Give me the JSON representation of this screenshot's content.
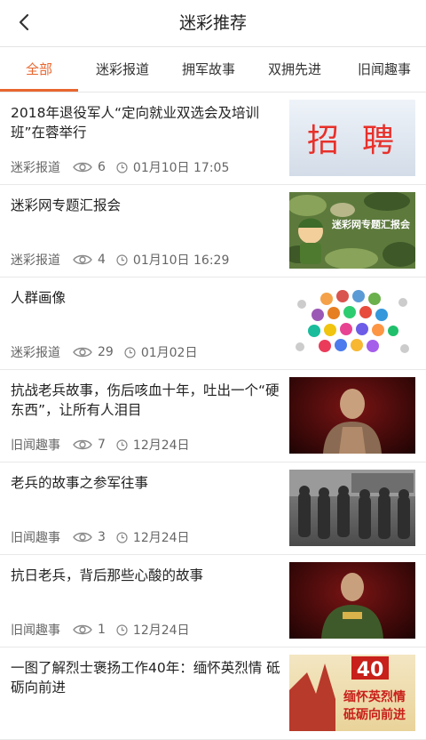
{
  "header": {
    "title": "迷彩推荐"
  },
  "tabs": [
    {
      "label": "全部",
      "active": true
    },
    {
      "label": "迷彩报道"
    },
    {
      "label": "拥军故事"
    },
    {
      "label": "双拥先进"
    },
    {
      "label": "旧闻趣事"
    }
  ],
  "colors": {
    "accent": "#e8662e",
    "text": "#222222",
    "meta": "#666666",
    "divider": "#e8e8e8"
  },
  "articles": [
    {
      "title": "2018年退役军人“定向就业双选会及培训班”在蓉举行",
      "source": "迷彩报道",
      "views": "6",
      "time": "01月10日 17:05",
      "thumb": {
        "text1": "招",
        "text2": "聘"
      }
    },
    {
      "title": "迷彩网专题汇报会",
      "source": "迷彩报道",
      "views": "4",
      "time": "01月10日 16:29",
      "thumb": {
        "text": "迷彩网专题汇报会"
      }
    },
    {
      "title": "人群画像",
      "source": "迷彩报道",
      "views": "29",
      "time": "01月02日",
      "thumb": {
        "kind": "people-avatars"
      }
    },
    {
      "title": "抗战老兵故事，伤后咳血十年，吐出一个“硬东西”，让所有人泪目",
      "source": "旧闻趣事",
      "views": "7",
      "time": "12月24日",
      "thumb": {
        "kind": "veteran-photo"
      }
    },
    {
      "title": "老兵的故事之参军往事",
      "source": "旧闻趣事",
      "views": "3",
      "time": "12月24日",
      "thumb": {
        "kind": "soldiers-photo"
      }
    },
    {
      "title": "抗日老兵，背后那些心酸的故事",
      "source": "旧闻趣事",
      "views": "1",
      "time": "12月24日",
      "thumb": {
        "kind": "veteran-photo"
      }
    },
    {
      "title": "一图了解烈士褒扬工作40年：缅怀英烈情 砥砺向前进",
      "source": "",
      "views": "",
      "time": "",
      "thumb": {
        "number": "40",
        "line1": "缅怀英烈情",
        "line2": "砥砺向前进"
      }
    }
  ]
}
